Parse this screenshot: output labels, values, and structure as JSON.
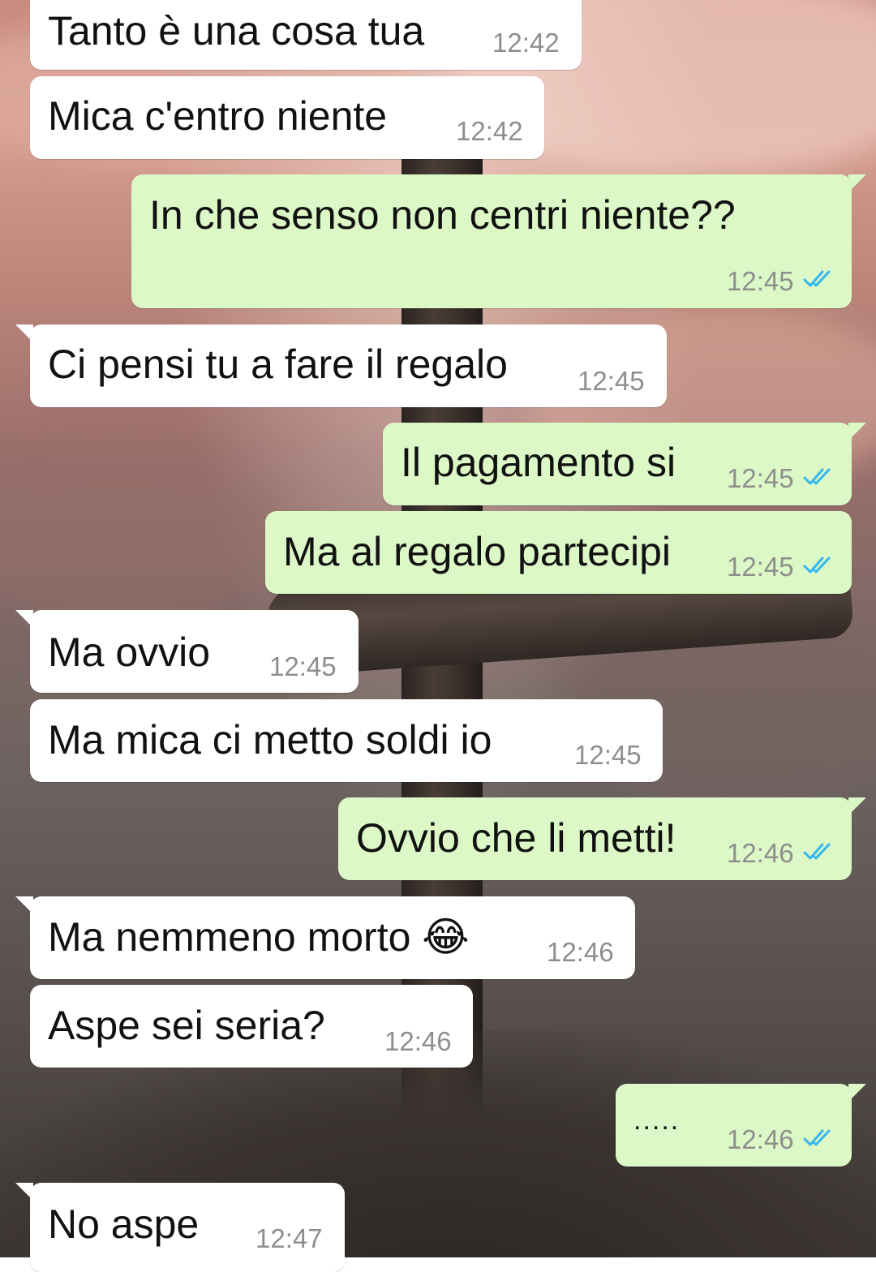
{
  "chat": {
    "tick_color": "#34b7f1",
    "incoming_bubble_color": "#ffffff",
    "outgoing_bubble_color": "#dcf8c6",
    "messages": [
      {
        "direction": "in",
        "text": "Tanto è una cosa tua",
        "time": "12:42"
      },
      {
        "direction": "in",
        "text": "Mica c'entro niente",
        "time": "12:42"
      },
      {
        "direction": "out",
        "text": "In che senso non centri niente??",
        "time": "12:45",
        "status": "read-double-check-icon"
      },
      {
        "direction": "in",
        "text": "Ci pensi tu a fare il regalo",
        "time": "12:45"
      },
      {
        "direction": "out",
        "text": "Il pagamento si",
        "time": "12:45",
        "status": "read-double-check-icon"
      },
      {
        "direction": "out",
        "text": "Ma al regalo partecipi",
        "time": "12:45",
        "status": "read-double-check-icon"
      },
      {
        "direction": "in",
        "text": "Ma ovvio",
        "time": "12:45"
      },
      {
        "direction": "in",
        "text": "Ma mica ci metto soldi io",
        "time": "12:45"
      },
      {
        "direction": "out",
        "text": "Ovvio che li metti!",
        "time": "12:46",
        "status": "read-double-check-icon"
      },
      {
        "direction": "in",
        "text": "Ma nemmeno morto 😂",
        "time": "12:46"
      },
      {
        "direction": "in",
        "text": "Aspe sei seria?",
        "time": "12:46"
      },
      {
        "direction": "out",
        "text": ".....",
        "time": "12:46",
        "status": "read-double-check-icon"
      },
      {
        "direction": "in",
        "text": "No aspe",
        "time": "12:47"
      }
    ]
  }
}
